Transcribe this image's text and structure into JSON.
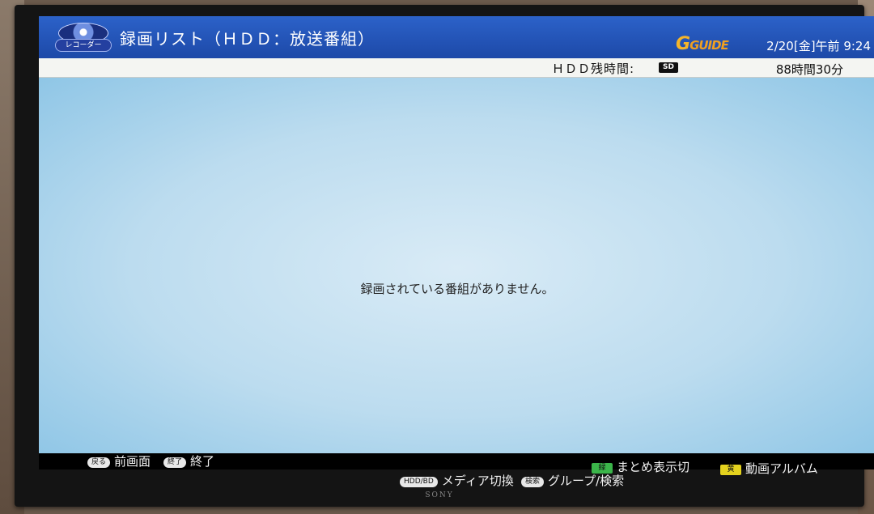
{
  "header": {
    "recorder_label": "レコーダー",
    "title": "録画リスト（ＨＤＤ：放送番組）",
    "logo_text_g": "G",
    "logo_text_rest": "GUIDE",
    "datetime": "2/20[金]午前 9:24"
  },
  "info_bar": {
    "hdd_label": "ＨＤＤ残時間:",
    "sd_badge": "SD",
    "hdd_value": "88時間30分"
  },
  "content": {
    "empty_message": "録画されている番組がありません。"
  },
  "footer": {
    "back": {
      "key": "戻る",
      "label": "前画面"
    },
    "exit": {
      "key": "終了",
      "label": "終了"
    },
    "media": {
      "key": "HDD/BD",
      "label": "メディア切換"
    },
    "group": {
      "key": "検索",
      "label": "グループ/検索"
    },
    "green": {
      "key": "緑",
      "label": "まとめ表示切",
      "color": "#3bb54a"
    },
    "yellow": {
      "key": "黄",
      "label": "動画アルバム",
      "color": "#e4d21e"
    }
  },
  "brand": "SONY"
}
